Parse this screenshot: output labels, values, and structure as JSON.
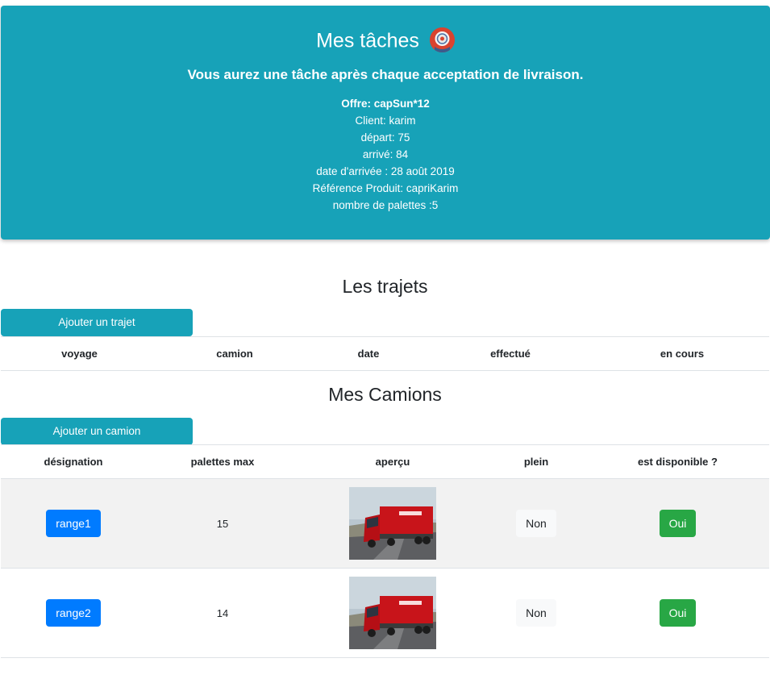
{
  "header": {
    "title": "Mes tâches",
    "subtitle": "Vous aurez une tâche après chaque acceptation de livraison.",
    "offer": "Offre: capSun*12",
    "client": "Client: karim",
    "depart": "départ: 75",
    "arrive": "arrivé: 84",
    "arrival_date": "date d'arrivée : 28 août 2019",
    "product_ref": "Référence Produit: capriKarim",
    "pallets": "nombre de palettes :5",
    "avatar_icon": "avatar-icon"
  },
  "trajets": {
    "title": "Les trajets",
    "add_button": "Ajouter un trajet",
    "columns": [
      "voyage",
      "camion",
      "date",
      "effectué",
      "en cours"
    ]
  },
  "camions": {
    "title": "Mes Camions",
    "add_button": "Ajouter un camion",
    "columns": [
      "désignation",
      "palettes max",
      "aperçu",
      "plein",
      "est disponible ?"
    ],
    "rows": [
      {
        "designation": "range1",
        "palettes_max": "15",
        "preview_icon": "truck-image",
        "plein": "Non",
        "disponible": "Oui"
      },
      {
        "designation": "range2",
        "palettes_max": "14",
        "preview_icon": "truck-image",
        "plein": "Non",
        "disponible": "Oui"
      }
    ]
  },
  "colors": {
    "teal": "#17a2b8",
    "blue": "#007bff",
    "green": "#28a745",
    "light": "#f8f9fa"
  }
}
